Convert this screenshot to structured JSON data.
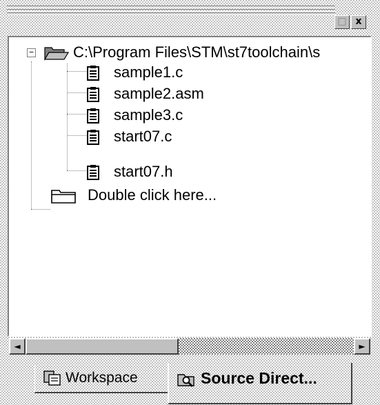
{
  "window": {
    "minimize_glyph": "□",
    "close_glyph": "x"
  },
  "tree": {
    "root": {
      "label": "C:\\Program Files\\STM\\st7toolchain\\s",
      "expander": "−",
      "icon": "open-folder-icon",
      "children": [
        {
          "label": "sample1.c",
          "icon": "document-icon"
        },
        {
          "label": "sample2.asm",
          "icon": "document-icon"
        },
        {
          "label": "sample3.c",
          "icon": "document-icon"
        },
        {
          "label": "start07.c",
          "icon": "document-icon"
        },
        {
          "label": "start07.h",
          "icon": "document-icon"
        }
      ]
    },
    "placeholder": {
      "label": "Double click here...",
      "icon": "closed-folder-icon"
    }
  },
  "scrollbar": {
    "left_arrow": "◄",
    "right_arrow": "►"
  },
  "tabs": [
    {
      "label": "Workspace",
      "icon": "workspace-icon",
      "active": false
    },
    {
      "label": "Source Direct...",
      "icon": "search-folder-icon",
      "active": true
    }
  ]
}
